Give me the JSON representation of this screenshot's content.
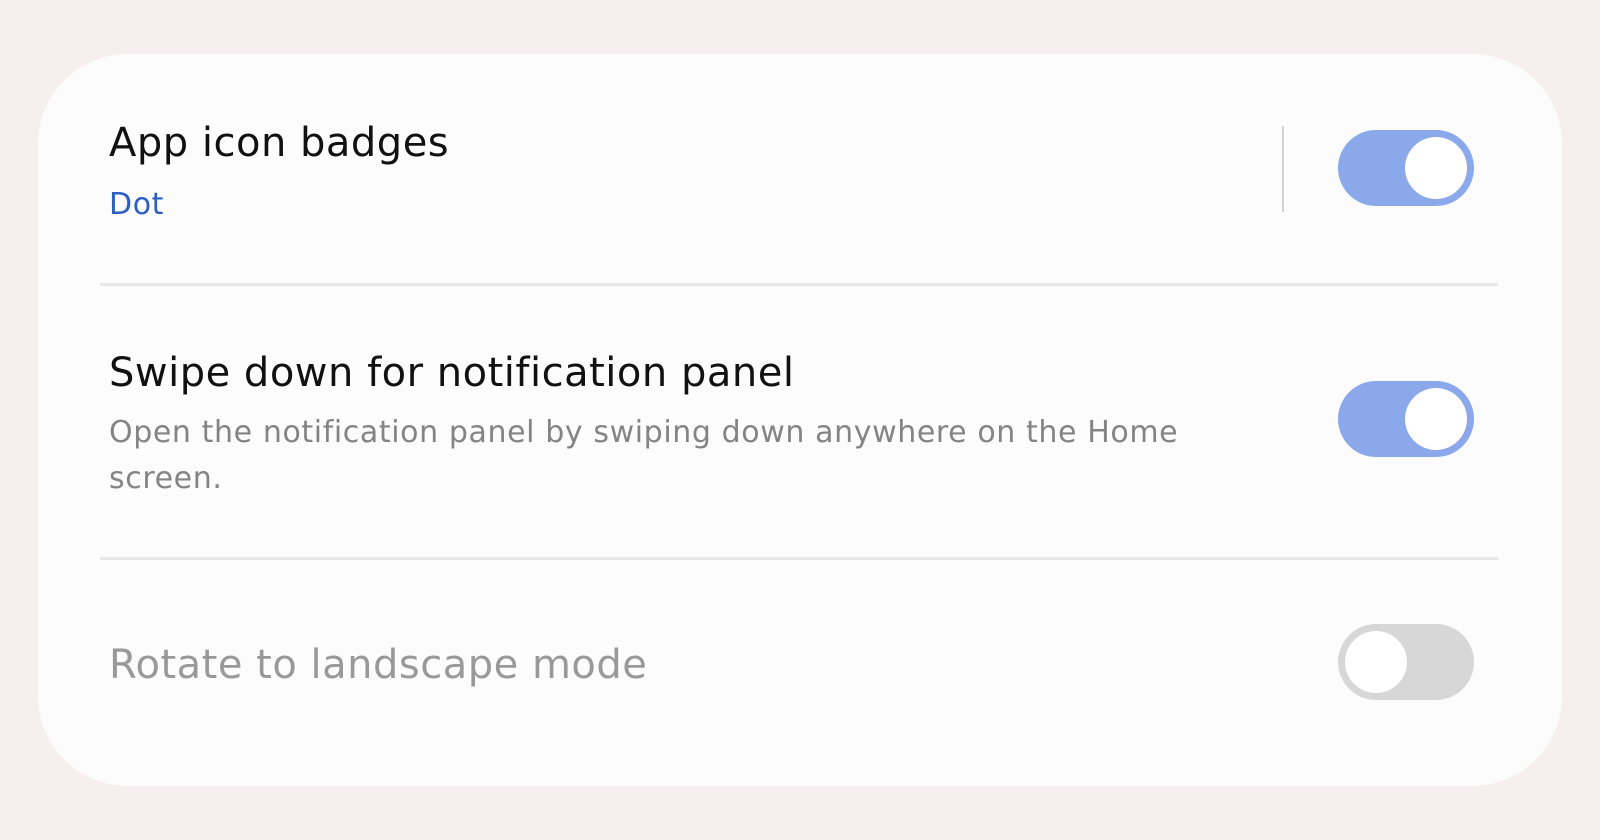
{
  "settings": {
    "items": [
      {
        "title": "App icon badges",
        "subtitle": "Dot",
        "enabled": true,
        "dimmed": false
      },
      {
        "title": "Swipe down for notification panel",
        "subtitle": "Open the notification panel by swiping down anywhere on the Home screen.",
        "enabled": true,
        "dimmed": false
      },
      {
        "title": "Rotate to landscape mode",
        "subtitle": "",
        "enabled": false,
        "dimmed": true
      }
    ]
  },
  "colors": {
    "background": "#f5f0ef",
    "card": "#fcfcfc",
    "toggle_on": "#8aa8ea",
    "toggle_off": "#d7d7d7",
    "accent_text": "#2d5fc0"
  }
}
